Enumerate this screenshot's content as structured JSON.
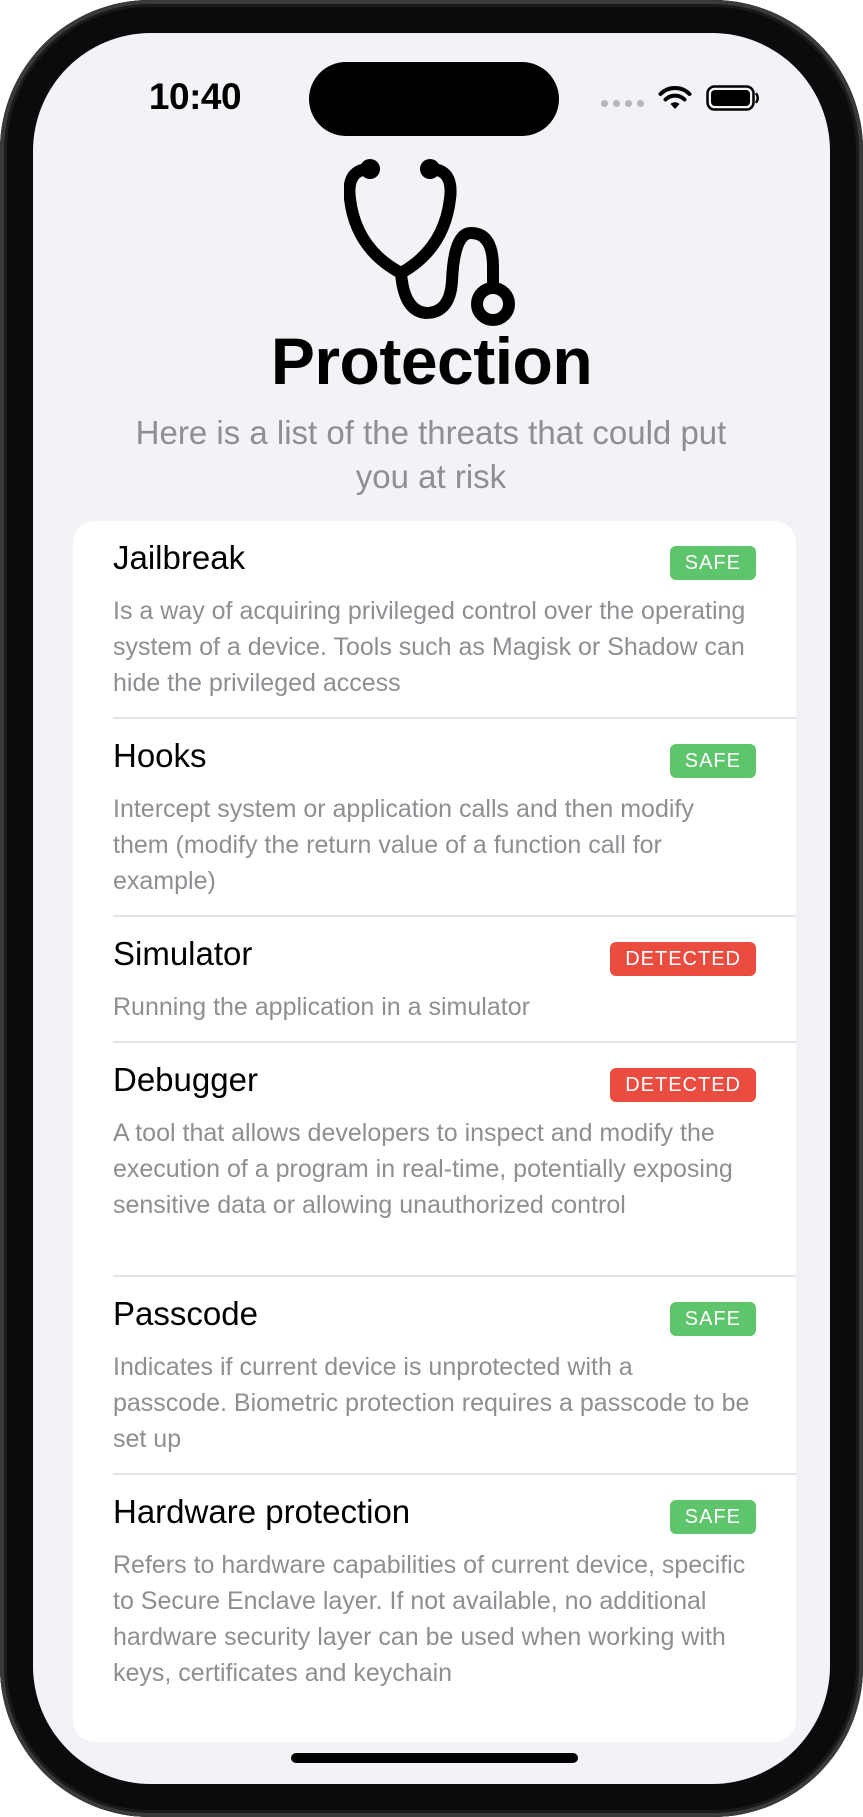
{
  "status_bar": {
    "time": "10:40",
    "icons": [
      "signal-dots-icon",
      "wifi-icon",
      "battery-icon"
    ]
  },
  "header": {
    "icon": "stethoscope-icon",
    "title": "Protection",
    "subtitle": "Here is a list of the threats that could put you at risk"
  },
  "colors": {
    "safe": "#5fc56d",
    "detected": "#ea4d3f",
    "background": "#f2f2f7",
    "secondary_text": "#8e8e93"
  },
  "threats": [
    {
      "name": "Jailbreak",
      "status": "SAFE",
      "description": "Is a way of acquiring privileged control over the operating system of a device. Tools such as Magisk or Shadow can hide the privileged access"
    },
    {
      "name": "Hooks",
      "status": "SAFE",
      "description": "Intercept system or application calls and then modify them (modify the return value of a function call for example)"
    },
    {
      "name": "Simulator",
      "status": "DETECTED",
      "description": "Running the application in a simulator"
    },
    {
      "name": "Debugger",
      "status": "DETECTED",
      "description": "A tool that allows developers to inspect and modify the execution of a program in real-time, potentially exposing sensitive data or allowing unauthorized control"
    },
    {
      "name": "Passcode",
      "status": "SAFE",
      "description": "Indicates if current device is unprotected with a passcode. Biometric protection requires a passcode to be set up"
    },
    {
      "name": "Hardware protection",
      "status": "SAFE",
      "description": "Refers to hardware capabilities of current device, specific to Secure Enclave layer. If not available, no additional hardware security layer can be used when working with keys, certificates and keychain"
    }
  ]
}
